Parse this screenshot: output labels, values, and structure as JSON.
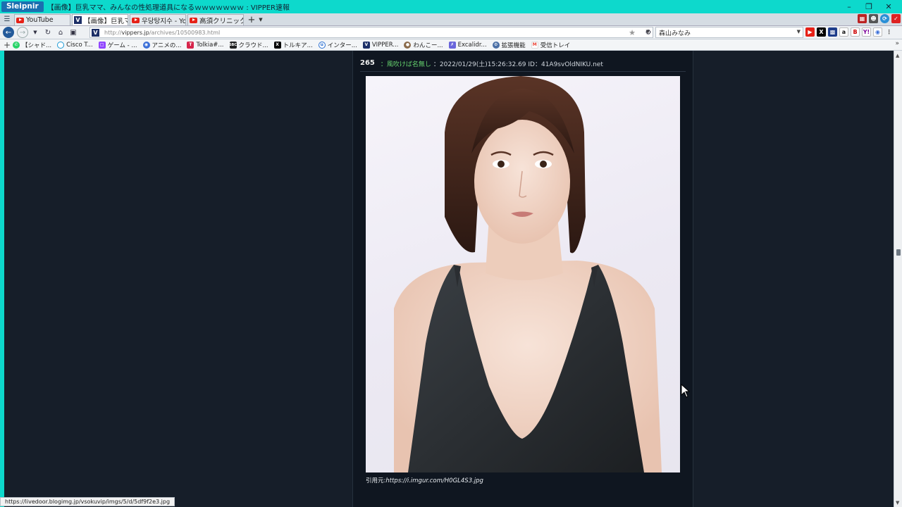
{
  "browser": {
    "app_name": "Sleipnir",
    "window_title": "【画像】巨乳ママ、みんなの性処理道具になるｗｗｗｗｗｗｗ : VIPPER速報"
  },
  "tabs": [
    {
      "label": "YouTube",
      "icon": "youtube-icon",
      "active": false
    },
    {
      "label": "【画像】巨乳ママ...",
      "icon": "vipper-icon",
      "active": true
    },
    {
      "label": "우당탕지수 - Yo...",
      "icon": "youtube-icon",
      "active": false
    },
    {
      "label": "高須クリニックチャ...",
      "icon": "youtube-icon",
      "active": false
    }
  ],
  "address": {
    "url_prefix": "http://",
    "url_host": "vippers.jp",
    "url_path": "/archives/10500983.html"
  },
  "search": {
    "query": "森山みなみ"
  },
  "bookmarks": [
    {
      "label": "【シャド...",
      "icon": "whatsapp-icon",
      "color": "#25d366"
    },
    {
      "label": "Cisco T...",
      "icon": "cisco-icon",
      "color": "#1b9ad6"
    },
    {
      "label": "ゲーム - ...",
      "icon": "twitch-icon",
      "color": "#9146ff"
    },
    {
      "label": "アニメの...",
      "icon": "globe-icon",
      "color": "#3b6fd8"
    },
    {
      "label": "Tolkia#...",
      "icon": "tolkia-icon",
      "color": "#d6244a"
    },
    {
      "label": "クラウド...",
      "icon": "sbc-icon",
      "color": "#222222"
    },
    {
      "label": "トルキア...",
      "icon": "x-icon",
      "color": "#000000"
    },
    {
      "label": "インター...",
      "icon": "uu-icon",
      "color": "#2a6fd1"
    },
    {
      "label": "VIPPER...",
      "icon": "vipper-icon",
      "color": "#1c2f67"
    },
    {
      "label": "わんこー...",
      "icon": "dog-icon",
      "color": "#8a6a4a"
    },
    {
      "label": "Excalidr...",
      "icon": "excalidraw-icon",
      "color": "#6965db"
    },
    {
      "label": "拡張機能",
      "icon": "extension-icon",
      "color": "#4a6fa5"
    },
    {
      "label": "受信トレイ",
      "icon": "gmail-icon",
      "color": "#ea4335"
    }
  ],
  "post": {
    "number": "265",
    "name": "：風吹けば名無し",
    "meta": "：2022/01/29(土)15:26:32.69 ID：41A9svOldNIKU.net",
    "caption_prefix": "引用元:",
    "caption_link": "https://i.imgur.com/H0GL4S3.jpg"
  },
  "status": {
    "text": "https://livedoor.blogimg.jp/vsokuvip/imgs/5/d/5df9f2e3.jpg"
  },
  "colors": {
    "accent": "#0dd9cc",
    "page_bg": "#161e29",
    "panel_bg": "#0f1620",
    "name_green": "#66d36e"
  }
}
